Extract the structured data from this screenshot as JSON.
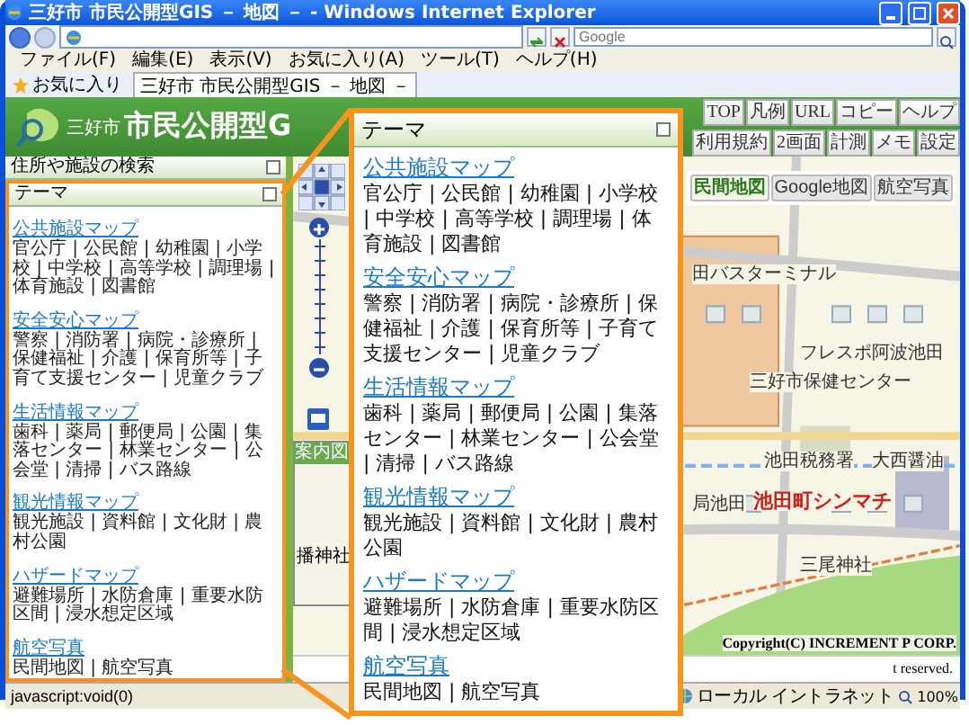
{
  "window": {
    "title": "三好市 市民公開型GIS － 地図 － - Windows Internet Explorer"
  },
  "address_bar": {
    "search_placeholder": "Google"
  },
  "menu_bar": [
    "ファイル(F)",
    "編集(E)",
    "表示(V)",
    "お気に入り(A)",
    "ツール(T)",
    "ヘルプ(H)"
  ],
  "favorites_bar": {
    "favorites": "お気に入り",
    "tab": "三好市 市民公開型GIS － 地図 －"
  },
  "header": {
    "city": "三好市",
    "title": "市民公開型G",
    "buttons_row_1": [
      "TOP",
      "凡例",
      "URL",
      "コピー",
      "ヘルプ"
    ],
    "buttons_row_2": [
      "利用規約",
      "2画面",
      "計測",
      "メモ",
      "設定"
    ]
  },
  "left_panel": {
    "search_header": "住所や施設の検索",
    "theme_header": "テーマ",
    "sections": [
      {
        "title": "公共施設マップ",
        "items": "官公庁 | 公民館 | 幼稚園 | 小学校 | 中学校 | 高等学校 | 調理場 | 体育施設 | 図書館"
      },
      {
        "title": "安全安心マップ",
        "items": "警察 | 消防署 | 病院・診療所 | 保健福祉 | 介護 | 保育所等 | 子育て支援センター | 児童クラブ"
      },
      {
        "title": "生活情報マップ",
        "items": "歯科 | 薬局 | 郵便局 | 公園 | 集落センター | 林業センター | 公会堂 | 清掃 | バス路線"
      },
      {
        "title": "観光情報マップ",
        "items": "観光施設 | 資料館 | 文化財 | 農村公園"
      },
      {
        "title": "ハザードマップ",
        "items": "避難場所 | 水防倉庫 | 重要水防区間 | 浸水想定区域"
      },
      {
        "title": "航空写真",
        "items": "民間地図 | 航空写真"
      }
    ]
  },
  "map": {
    "map_types": [
      {
        "label": "民間地図",
        "selected": true
      },
      {
        "label": "Google地図",
        "selected": false
      },
      {
        "label": "航空写真",
        "selected": false
      }
    ],
    "guide_map_title": "案内図",
    "guide_labels": [
      "播神社"
    ],
    "labels": [
      {
        "text": "田バスターミナル",
        "kind": "place"
      },
      {
        "text": "フレスポ阿波池田",
        "kind": "place"
      },
      {
        "text": "三好市保健センター",
        "kind": "place"
      },
      {
        "text": "池田税務署",
        "kind": "place"
      },
      {
        "text": "大西醤油",
        "kind": "place"
      },
      {
        "text": "局池田",
        "kind": "place"
      },
      {
        "text": "池田町シンマチ",
        "kind": "district"
      },
      {
        "text": "三尾神社",
        "kind": "place"
      }
    ],
    "copyright": "Copyright(C) INCREMENT P CORP.",
    "footer_text": "t reserved."
  },
  "status_bar": {
    "text": "javascript:void(0)",
    "zone": "ローカル イントラネット",
    "zoom": "100%"
  },
  "callout": {
    "header": "テーマ",
    "sections": [
      {
        "title": "公共施設マップ",
        "items": "官公庁 | 公民館 | 幼稚園 | 小学校 | 中学校 | 高等学校 | 調理場 | 体育施設 | 図書館"
      },
      {
        "title": "安全安心マップ",
        "items": "警察 | 消防署 | 病院・診療所 | 保健福祉 | 介護 | 保育所等 | 子育て支援センター | 児童クラブ"
      },
      {
        "title": "生活情報マップ",
        "items": "歯科 | 薬局 | 郵便局 | 公園 | 集落センター | 林業センター | 公会堂 | 清掃 | バス路線"
      },
      {
        "title": "観光情報マップ",
        "items": "観光施設 | 資料館 | 文化財 | 農村公園"
      },
      {
        "title": "ハザードマップ",
        "items": "避難場所 | 水防倉庫 | 重要水防区間 | 浸水想定区域"
      },
      {
        "title": "航空写真",
        "items": "民間地図 | 航空写真"
      }
    ]
  }
}
